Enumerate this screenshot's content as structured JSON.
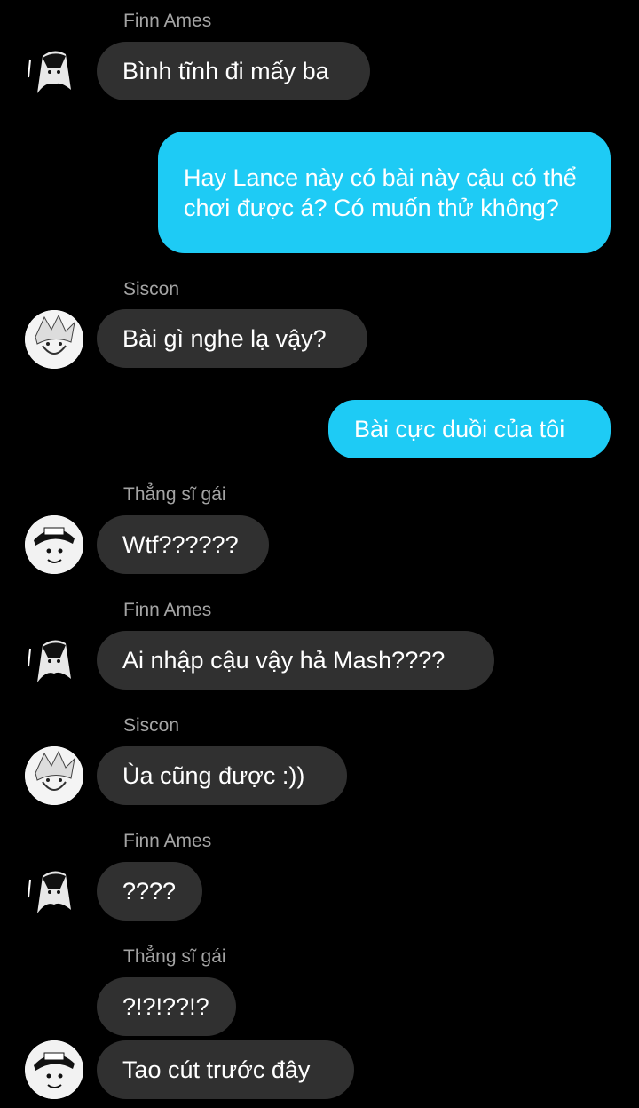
{
  "colors": {
    "background": "#000000",
    "incoming_bubble": "#303030",
    "outgoing_bubble": "#1ecbf5",
    "sender_name": "#a4a4a4",
    "text": "#ffffff"
  },
  "messages": [
    {
      "type": "in",
      "sender": "Finn Ames",
      "avatar": "finn-ames-avatar",
      "text": "Bình tĩnh đi mấy ba"
    },
    {
      "type": "out",
      "text": "Hay Lance này có bài này cậu có thể chơi được á? Có muốn thử không?"
    },
    {
      "type": "in",
      "sender": "Siscon",
      "avatar": "siscon-avatar",
      "text": "Bài gì nghe lạ vậy?"
    },
    {
      "type": "out",
      "text": "Bài cực duồi của tôi"
    },
    {
      "type": "in",
      "sender": "Thẳng sĩ gái",
      "avatar": "thang-si-gai-avatar",
      "text": "Wtf??????"
    },
    {
      "type": "in",
      "sender": "Finn Ames",
      "avatar": "finn-ames-avatar",
      "text": "Ai nhập cậu vậy hả Mash????"
    },
    {
      "type": "in",
      "sender": "Siscon",
      "avatar": "siscon-avatar",
      "text": "Ùa cũng được :))"
    },
    {
      "type": "in",
      "sender": "Finn Ames",
      "avatar": "finn-ames-avatar",
      "text": "????"
    },
    {
      "type": "in",
      "sender": "Thẳng sĩ gái",
      "avatar": "thang-si-gai-avatar",
      "text": "?!?!??!?"
    },
    {
      "type": "in",
      "sender": null,
      "avatar": "thang-si-gai-avatar",
      "text": "Tao cút trước đây"
    }
  ]
}
